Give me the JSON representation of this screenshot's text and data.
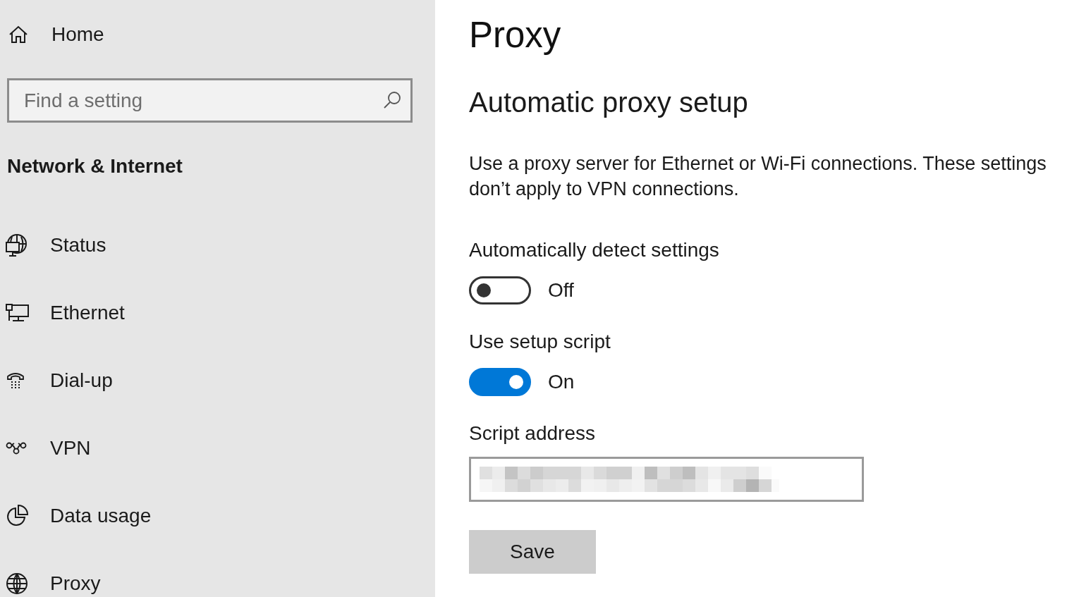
{
  "sidebar": {
    "home": {
      "label": "Home"
    },
    "search": {
      "placeholder": "Find a setting"
    },
    "section_title": "Network & Internet",
    "items": [
      {
        "label": "Status"
      },
      {
        "label": "Ethernet"
      },
      {
        "label": "Dial-up"
      },
      {
        "label": "VPN"
      },
      {
        "label": "Data usage"
      },
      {
        "label": "Proxy"
      }
    ]
  },
  "page": {
    "title": "Proxy",
    "section_title": "Automatic proxy setup",
    "description": "Use a proxy server for Ethernet or Wi-Fi connections. These settings don’t apply to VPN connections.",
    "toggles": [
      {
        "label": "Automatically detect settings",
        "on": false,
        "state_text": "Off"
      },
      {
        "label": "Use setup script",
        "on": true,
        "state_text": "On"
      }
    ],
    "script_address": {
      "label": "Script address"
    },
    "save_button": "Save"
  }
}
